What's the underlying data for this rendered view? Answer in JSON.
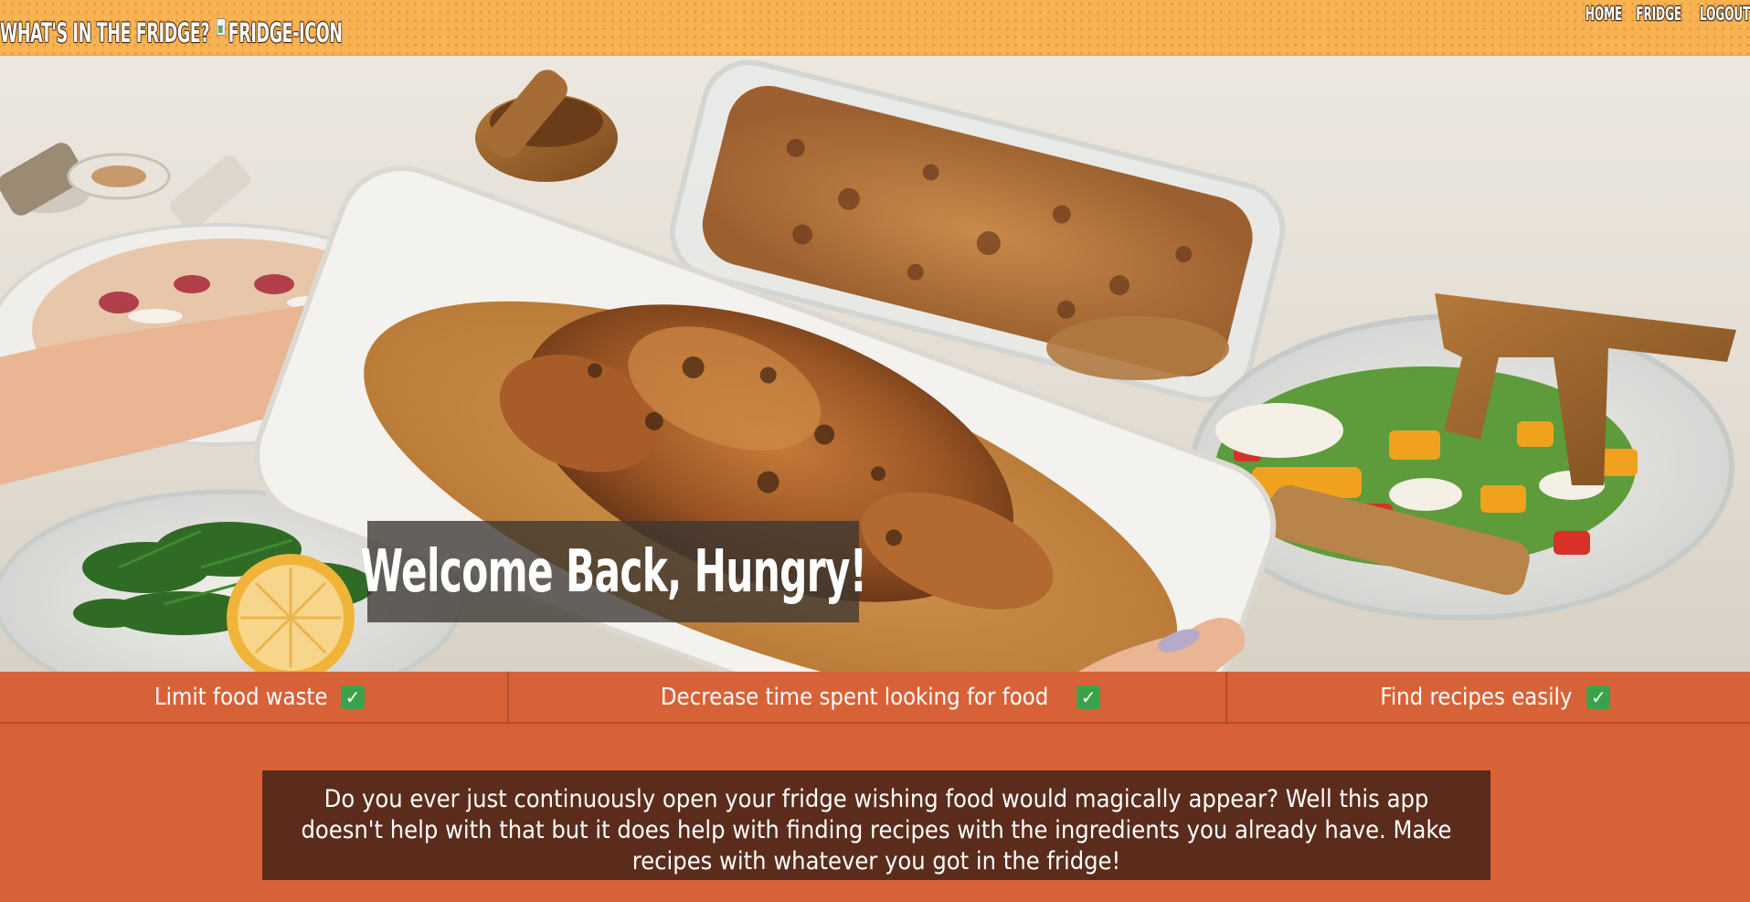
{
  "header": {
    "title": "WHAT'S IN THE FRIDGE?",
    "logo_alt": "FRIDGE-ICON",
    "nav": [
      {
        "label": "HOME"
      },
      {
        "label": "FRIDGE"
      },
      {
        "label": "LOGOUT"
      }
    ]
  },
  "hero": {
    "welcome": "Welcome Back, Hungry!"
  },
  "features": [
    {
      "label": "Limit food waste"
    },
    {
      "label": "Decrease time spent looking for food"
    },
    {
      "label": "Find recipes easily"
    }
  ],
  "check_icon": "check-mark-emoji",
  "about": {
    "text": "Do you ever just continuously open your fridge wishing food would magically appear? Well this app doesn't help with that but it does help with finding recipes with the ingredients you already have. Make recipes with whatever you got in the fridge!"
  },
  "colors": {
    "header_bg": "#f9b352",
    "page_bg": "#d86238",
    "about_bg": "#5b2c1c",
    "check_green": "#3aa34a"
  }
}
